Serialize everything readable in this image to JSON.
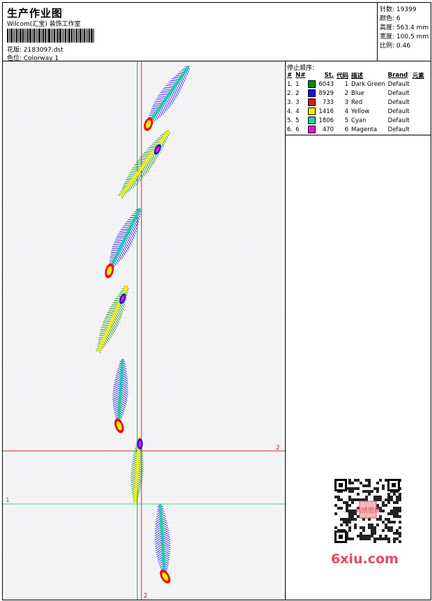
{
  "header": {
    "title": "生产作业图",
    "subtitle": "Wilcom(汇宝) 装饰工作室",
    "design_label": "花版: 2183097.dst",
    "colorway_label": "色位: Colorway 1"
  },
  "stats": [
    {
      "label": "针数:",
      "value": "19399"
    },
    {
      "label": "颜色:",
      "value": "6"
    },
    {
      "label": "高度:",
      "value": "563.4 mm"
    },
    {
      "label": "宽度:",
      "value": "100.5 mm"
    },
    {
      "label": "比例:",
      "value": "0.46"
    }
  ],
  "stop_sequence": {
    "title": "停止顺序:",
    "headers": [
      "#",
      "N#",
      "St.",
      "代码",
      "描述",
      "Brand",
      "元素"
    ],
    "rows": [
      {
        "idx": "1.",
        "n": "1",
        "color": "#0a8a14",
        "st": "6043",
        "code": "1",
        "desc": "Dark Green",
        "brand": "Default"
      },
      {
        "idx": "2.",
        "n": "2",
        "color": "#1414e6",
        "st": "8929",
        "code": "2",
        "desc": "Blue",
        "brand": "Default"
      },
      {
        "idx": "3.",
        "n": "3",
        "color": "#e61414",
        "st": "733",
        "code": "3",
        "desc": "Red",
        "brand": "Default"
      },
      {
        "idx": "4.",
        "n": "4",
        "color": "#f0f000",
        "st": "1416",
        "code": "4",
        "desc": "Yellow",
        "brand": "Default"
      },
      {
        "idx": "5.",
        "n": "5",
        "color": "#19d2a0",
        "st": "1806",
        "code": "5",
        "desc": "Cyan",
        "brand": "Default"
      },
      {
        "idx": "6.",
        "n": "6",
        "color": "#e614d2",
        "st": "470",
        "code": "6",
        "desc": "Magenta",
        "brand": "Default"
      }
    ]
  },
  "canvas": {
    "markers": {
      "one": "1",
      "two_right": "2",
      "two_bottom": "2"
    },
    "colors": {
      "red_line": "#e61e1e",
      "green_line": "#3cdc82",
      "guide_green": "#2a9a4a",
      "bg": "#f4f4f6"
    }
  },
  "watermark": {
    "text": "6xiu.com",
    "stamp": "刺绣图库"
  }
}
